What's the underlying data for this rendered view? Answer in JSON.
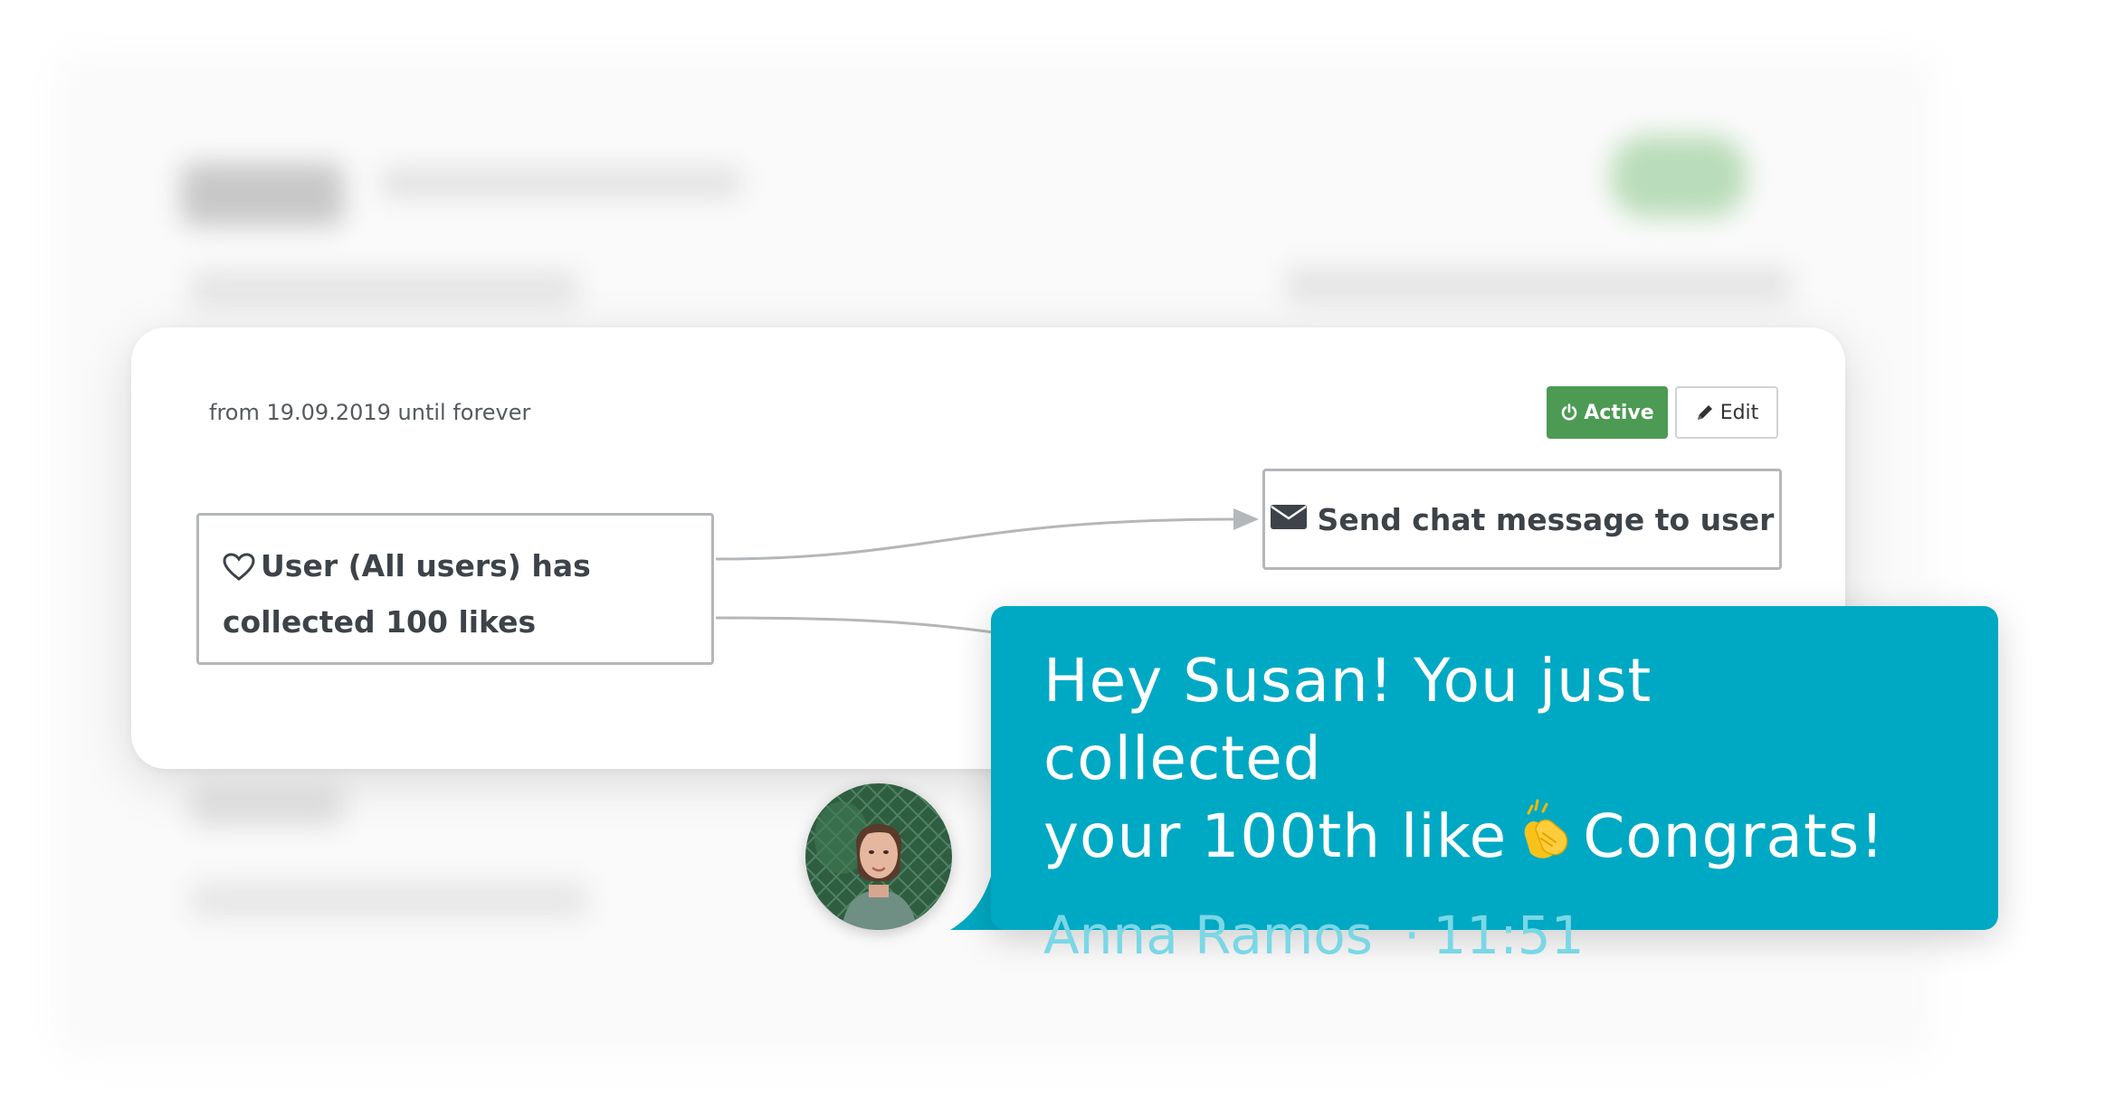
{
  "card": {
    "date_range": "from 19.09.2019 until forever",
    "active_button": "Active",
    "edit_button": "Edit"
  },
  "flow": {
    "trigger_line1": "User (All users) has",
    "trigger_line2": "collected 100 likes",
    "action_label": "Send chat message to user"
  },
  "message": {
    "line1": "Hey Susan! You just collected",
    "line2_before": "your 100th like",
    "line2_after": "Congrats!",
    "sender": "Anna Ramos",
    "separator": "·",
    "time": "11:51"
  },
  "colors": {
    "active_green": "#4c9a53",
    "bubble_teal": "#00a9c3",
    "meta_text": "#7ad7e6",
    "node_border": "#b4b7b9"
  },
  "icons": [
    "power-icon",
    "pencil-icon",
    "heart-icon",
    "envelope-icon",
    "clapping-hands-icon"
  ]
}
